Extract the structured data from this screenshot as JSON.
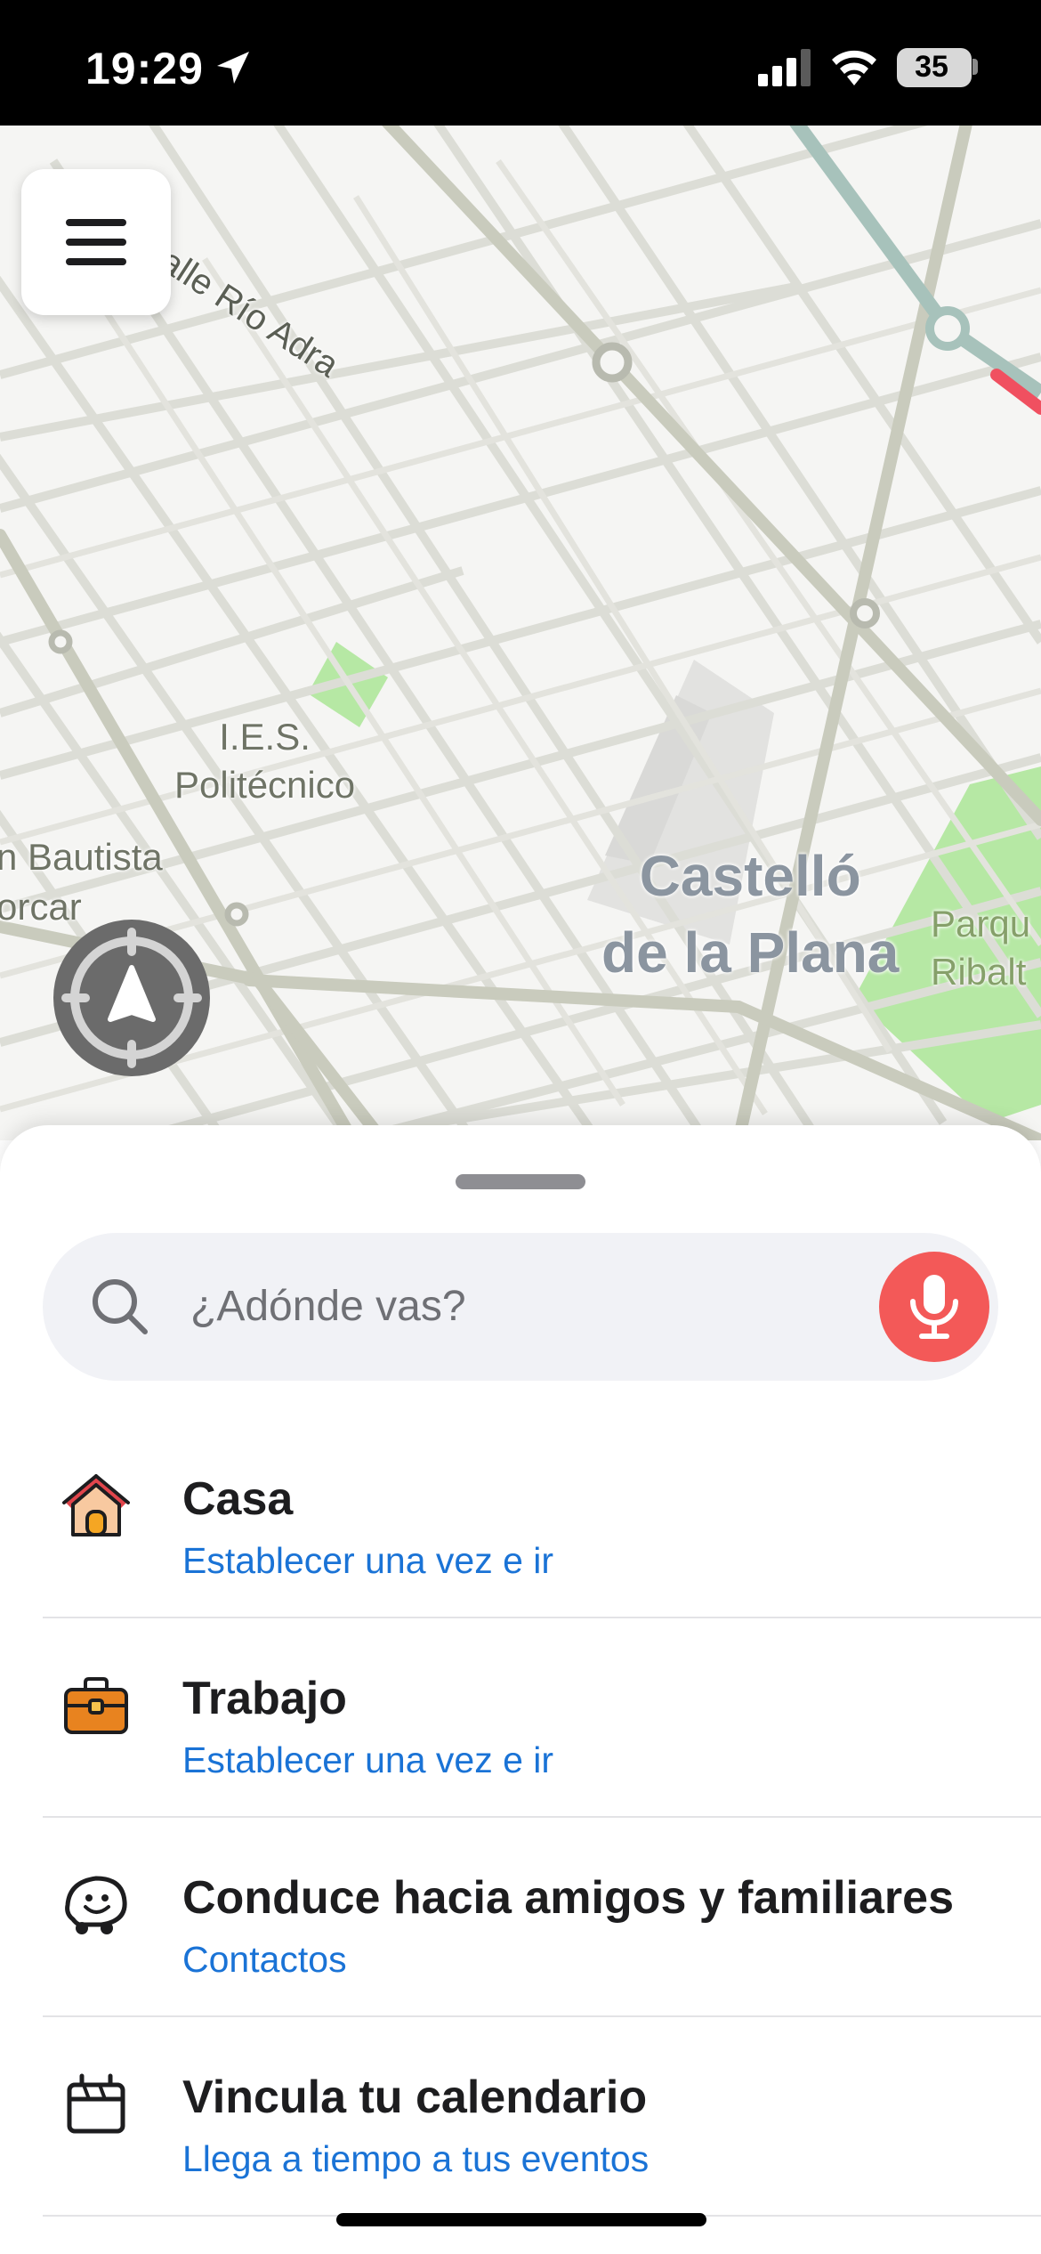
{
  "status_bar": {
    "time": "19:29",
    "battery": "35"
  },
  "map": {
    "street_label": "Calle Río Adra",
    "poi_label_line1": "I.E.S.",
    "poi_label_line2": "Politécnico",
    "bautista_line1": "n Bautista",
    "bautista_line2": "orcar",
    "city_label_line1": "Castelló",
    "city_label_line2": "de la Plana",
    "park_label_line1": "Parqu",
    "park_label_line2": "Ribalt"
  },
  "search": {
    "placeholder": "¿Adónde vas?"
  },
  "shortcuts": [
    {
      "title": "Casa",
      "subtitle": "Establecer una vez e ir",
      "icon": "house-icon"
    },
    {
      "title": "Trabajo",
      "subtitle": "Establecer una vez e ir",
      "icon": "briefcase-icon"
    },
    {
      "title": "Conduce hacia amigos y familiares",
      "subtitle": "Contactos",
      "icon": "waze-smile-icon"
    },
    {
      "title": "Vincula tu calendario",
      "subtitle": "Llega a tiempo a tus eventos",
      "icon": "calendar-icon"
    }
  ],
  "colors": {
    "link": "#1a73d6",
    "mic": "#f35958",
    "park": "#b6e8a4",
    "route": "#f05060"
  }
}
